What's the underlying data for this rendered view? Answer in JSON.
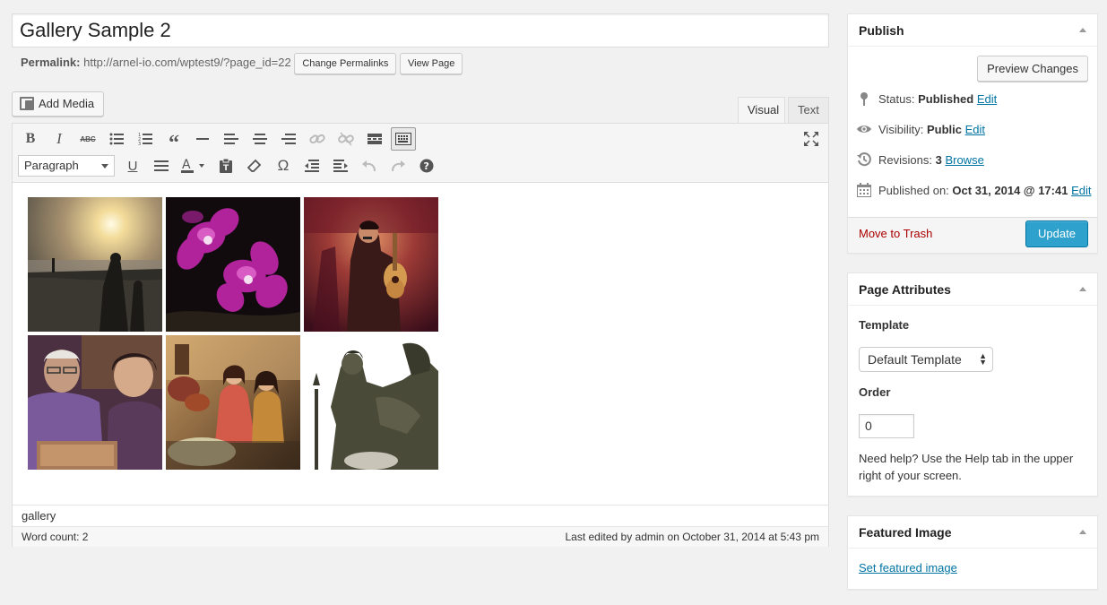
{
  "title": {
    "value": "Gallery Sample 2"
  },
  "permalink": {
    "label": "Permalink:",
    "url": "http://arnel-io.com/wptest9/?page_id=22",
    "change_label": "Change Permalinks",
    "view_label": "View Page"
  },
  "media": {
    "add_label": "Add Media"
  },
  "tabs": {
    "visual": "Visual",
    "text": "Text",
    "active": "visual"
  },
  "toolbar": {
    "row1": [
      "bold-icon",
      "italic-icon",
      "strikethrough-icon",
      "bullet-list-icon",
      "numbered-list-icon",
      "blockquote-icon",
      "horizontal-rule-icon",
      "align-left-icon",
      "align-center-icon",
      "align-right-icon",
      "link-icon",
      "unlink-icon",
      "read-more-icon",
      "toolbar-toggle-icon"
    ],
    "format_select": "Paragraph",
    "row2": [
      "underline-icon",
      "justify-icon",
      "text-color-icon",
      "paste-text-icon",
      "clear-formatting-icon",
      "special-character-icon",
      "outdent-icon",
      "indent-icon",
      "undo-icon",
      "redo-icon",
      "help-icon"
    ],
    "fullscreen": "fullscreen-icon"
  },
  "gallery": {
    "images": [
      {
        "name": "sunset-beach-photo",
        "colors": [
          "#c8a86a",
          "#7a6a52",
          "#2b2a25"
        ]
      },
      {
        "name": "purple-orchid-photo",
        "colors": [
          "#1b1014",
          "#b2259a",
          "#e060c8"
        ]
      },
      {
        "name": "guitar-performer-photo",
        "colors": [
          "#6a1e28",
          "#b84a3e",
          "#2a0d12"
        ]
      },
      {
        "name": "elderly-couple-photo",
        "colors": [
          "#5b3a5a",
          "#a07a8a",
          "#3b2430"
        ]
      },
      {
        "name": "women-in-room-photo",
        "colors": [
          "#8a6a3a",
          "#d08858",
          "#4a3222"
        ]
      },
      {
        "name": "statue-photo",
        "colors": [
          "#ffffff",
          "#5a5a48",
          "#2e2e24"
        ]
      }
    ]
  },
  "editor_status": {
    "path": "gallery",
    "word_count": "Word count: 2",
    "last_edited": "Last edited by admin on October 31, 2014 at 5:43 pm"
  },
  "publish": {
    "heading": "Publish",
    "preview_label": "Preview Changes",
    "status_label": "Status:",
    "status_value": "Published",
    "visibility_label": "Visibility:",
    "visibility_value": "Public",
    "revisions_label": "Revisions:",
    "revisions_value": "3",
    "browse_label": "Browse",
    "published_label": "Published on:",
    "published_value": "Oct 31, 2014 @ 17:41",
    "edit_label": "Edit",
    "trash_label": "Move to Trash",
    "update_label": "Update"
  },
  "page_attributes": {
    "heading": "Page Attributes",
    "template_label": "Template",
    "template_value": "Default Template",
    "order_label": "Order",
    "order_value": "0",
    "help_text": "Need help? Use the Help tab in the upper right of your screen."
  },
  "featured_image": {
    "heading": "Featured Image",
    "set_label": "Set featured image"
  },
  "colors": {
    "accent": "#2ea2cc",
    "link": "#0074a2",
    "trash": "#aa0000",
    "background": "#f1f1f1"
  }
}
